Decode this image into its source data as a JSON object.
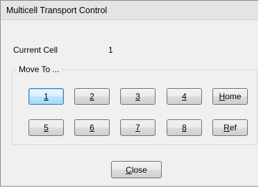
{
  "window": {
    "title": "Multicell Transport Control"
  },
  "current_cell": {
    "label": "Current Cell",
    "value": "1"
  },
  "move_to": {
    "group_label": "Move To ...",
    "buttons_row1": [
      "1",
      "2",
      "3",
      "4"
    ],
    "buttons_row2": [
      "5",
      "6",
      "7",
      "8"
    ],
    "home_label_first": "H",
    "home_label_rest": "ome",
    "ref_label_first": "R",
    "ref_label_rest": "ef"
  },
  "footer": {
    "close_label_first": "C",
    "close_label_rest": "lose"
  }
}
